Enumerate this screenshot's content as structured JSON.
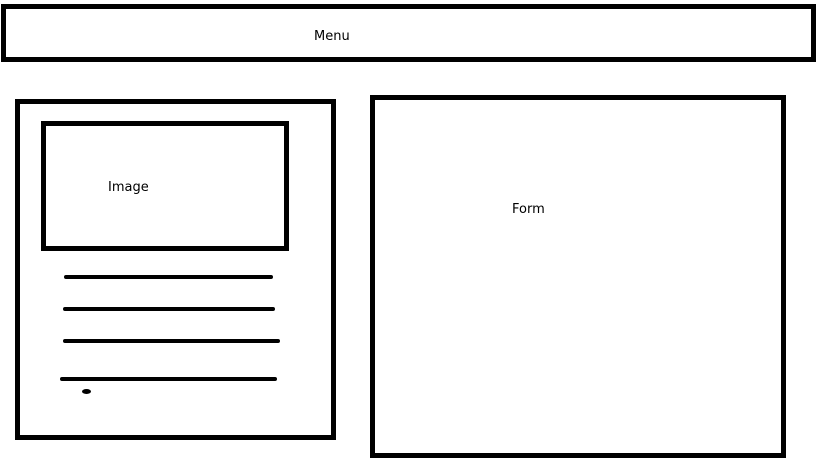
{
  "menu": {
    "label": "Menu"
  },
  "card": {
    "image_label": "Image"
  },
  "form": {
    "label": "Form"
  },
  "colors": {
    "stroke": "#000000",
    "background": "#ffffff"
  }
}
